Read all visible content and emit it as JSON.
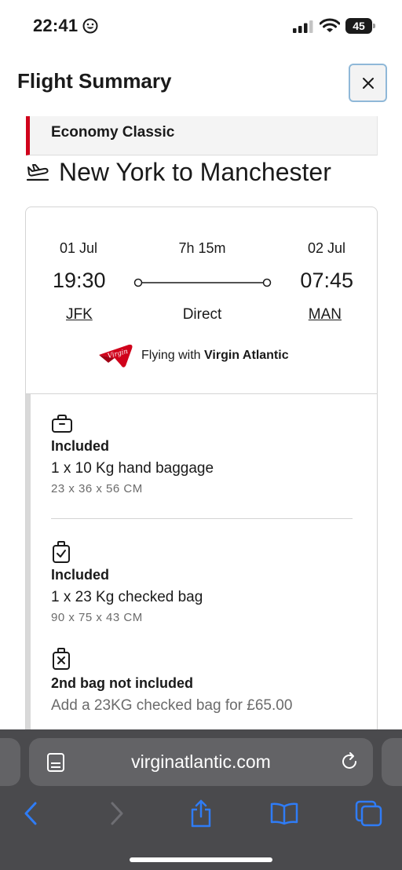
{
  "status_bar": {
    "time": "22:41",
    "battery": "45"
  },
  "header": {
    "title": "Flight Summary"
  },
  "cabin": {
    "label": "Economy Classic"
  },
  "route": {
    "title": "New York to Manchester"
  },
  "flight": {
    "departure_date": "01 Jul",
    "duration": "7h 15m",
    "arrival_date": "02 Jul",
    "departure_time": "19:30",
    "arrival_time": "07:45",
    "departure_airport": "JFK",
    "stops": "Direct",
    "arrival_airport": "MAN",
    "carrier_prefix": "Flying with",
    "carrier_name": "Virgin Atlantic",
    "carrier_logo_text": "Virgin"
  },
  "baggage": [
    {
      "icon": "hand-bag-icon",
      "status": "Included",
      "description": "1 x 10 Kg hand baggage",
      "dimensions": "23 x 36 x 56 CM"
    },
    {
      "icon": "checked-bag-icon",
      "status": "Included",
      "description": "1 x 23 Kg checked bag",
      "dimensions": "90 x 75 x 43 CM"
    },
    {
      "icon": "bag-not-included-icon",
      "status": "2nd bag not included",
      "description": "Add a 23KG checked bag for £65.00"
    }
  ],
  "browser": {
    "url": "virginatlantic.com"
  },
  "colors": {
    "brand_red": "#d0021b",
    "browser_bg": "#4a4a4d",
    "ios_blue": "#2f7cf6"
  }
}
